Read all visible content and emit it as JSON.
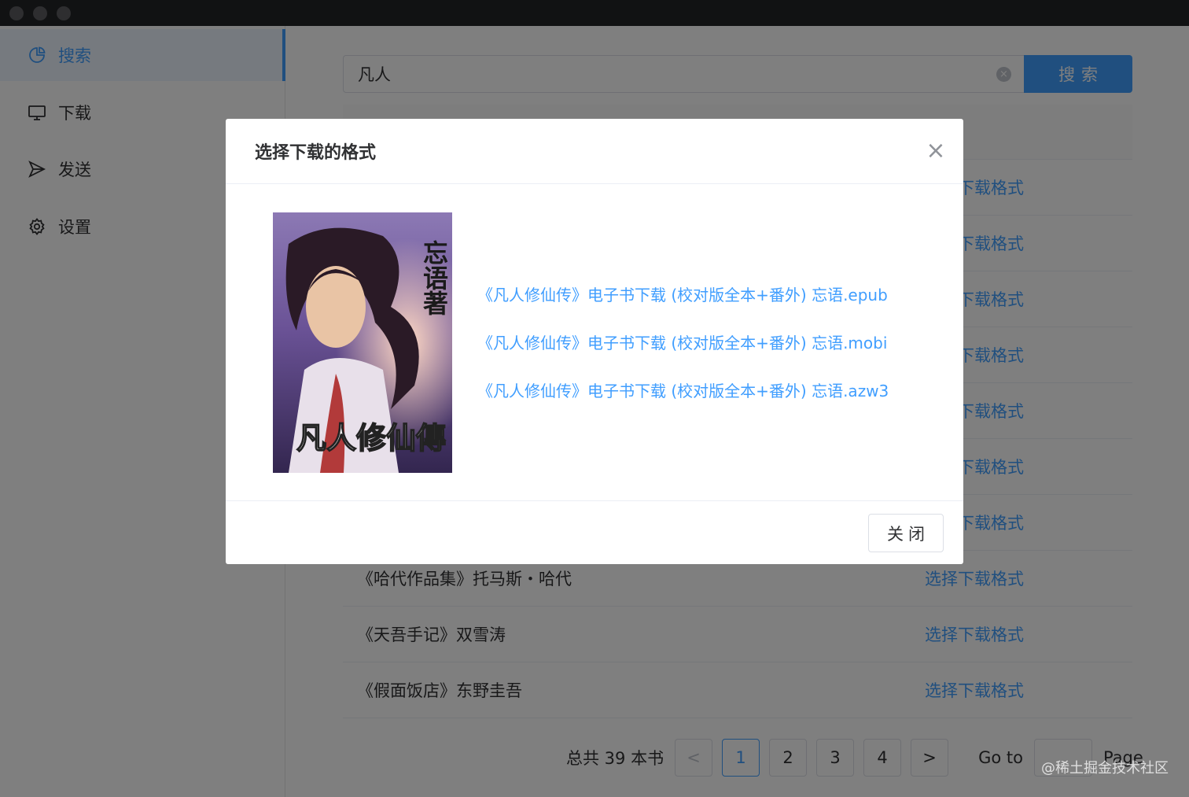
{
  "sidebar": {
    "items": [
      {
        "label": "搜索",
        "icon": "pie-chart-icon",
        "active": true
      },
      {
        "label": "下载",
        "icon": "monitor-icon",
        "active": false
      },
      {
        "label": "发送",
        "icon": "send-icon",
        "active": false
      },
      {
        "label": "设置",
        "icon": "gear-icon",
        "active": false
      }
    ]
  },
  "search": {
    "value": "凡人",
    "button_label": "搜索"
  },
  "results": {
    "rows": [
      {
        "title": "",
        "action": "选择下载格式"
      },
      {
        "title": "",
        "action": "选择下载格式"
      },
      {
        "title": "",
        "action": "选择下载格式"
      },
      {
        "title": "",
        "action": "选择下载格式"
      },
      {
        "title": "",
        "action": "选择下载格式"
      },
      {
        "title": "",
        "action": "选择下载格式"
      },
      {
        "title": "",
        "action": "选择下载格式"
      },
      {
        "title": "《哈代作品集》托马斯・哈代",
        "action": "选择下载格式"
      },
      {
        "title": "《天吾手记》双雪涛",
        "action": "选择下载格式"
      },
      {
        "title": "《假面饭店》东野圭吾",
        "action": "选择下载格式"
      }
    ]
  },
  "pagination": {
    "total": "总共 39 本书",
    "prev": "<",
    "pages": [
      "1",
      "2",
      "3",
      "4"
    ],
    "current": "1",
    "next": ">",
    "goto_label": "Go to",
    "page_label": "Page"
  },
  "dialog": {
    "title": "选择下载的格式",
    "close_icon": "×",
    "cover": {
      "author_text": "忘语著",
      "title_text": "凡人修仙傳"
    },
    "formats": [
      "《凡人修仙传》电子书下载 (校对版全本+番外) 忘语.epub",
      "《凡人修仙传》电子书下载 (校对版全本+番外) 忘语.mobi",
      "《凡人修仙传》电子书下载 (校对版全本+番外) 忘语.azw3"
    ],
    "close_button": "关闭"
  },
  "watermark": "@稀土掘金技术社区",
  "colors": {
    "accent": "#409eff",
    "text": "#303133",
    "border": "#dcdfe6"
  }
}
